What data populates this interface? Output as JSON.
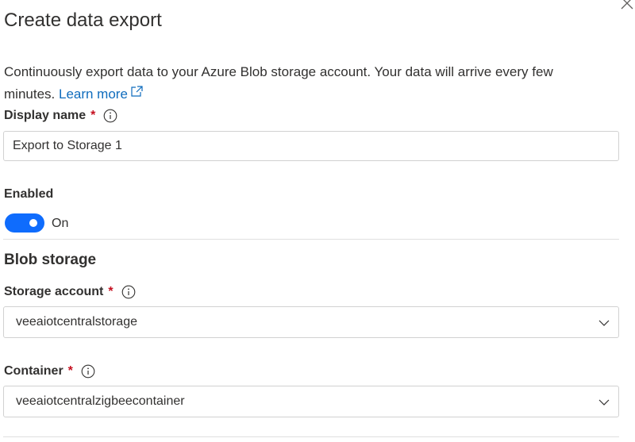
{
  "header": {
    "title": "Create data export"
  },
  "description": {
    "text": "Continuously export data to your Azure Blob storage account. Your data will arrive every few minutes.",
    "link_label": "Learn more"
  },
  "display_name": {
    "label": "Display name",
    "required_mark": "*",
    "value": "Export to Storage 1"
  },
  "enabled": {
    "label": "Enabled",
    "state_text": "On",
    "checked": true
  },
  "blob_storage": {
    "section_title": "Blob storage",
    "storage_account": {
      "label": "Storage account",
      "required_mark": "*",
      "selected": "veeaiotcentralstorage"
    },
    "container": {
      "label": "Container",
      "required_mark": "*",
      "selected": "veeaiotcentralzigbeecontainer"
    }
  },
  "colors": {
    "accent": "#0f6cfd",
    "link": "#0f6cbd",
    "required": "#c50f1f",
    "text": "#323130",
    "border": "#d1d1d1"
  },
  "icons": {
    "close": "close-icon",
    "external_link": "external-link-icon",
    "info": "info-icon",
    "chevron": "chevron-down-icon"
  }
}
